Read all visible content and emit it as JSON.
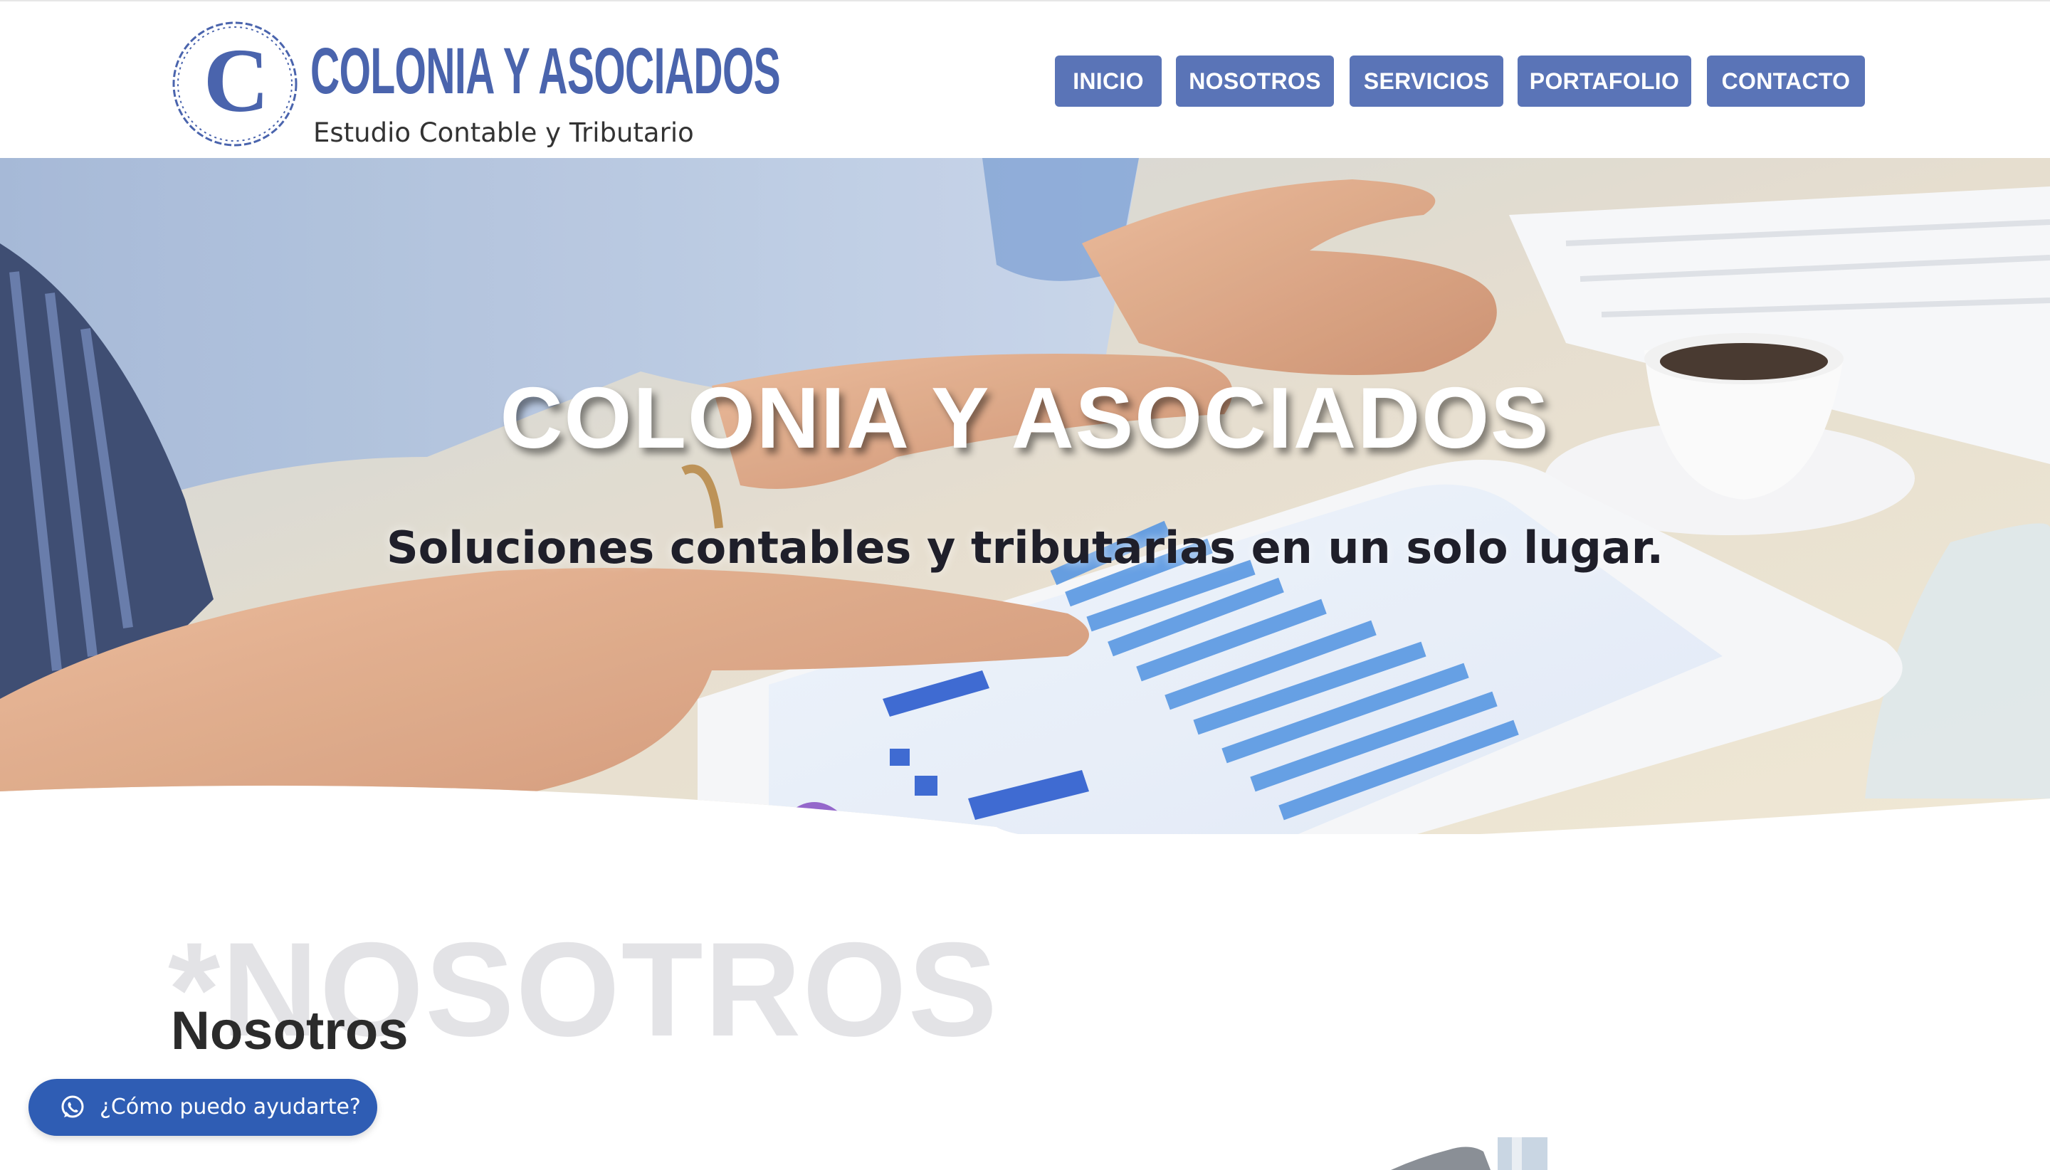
{
  "brand": {
    "logo_letter": "C",
    "name": "COLONIA Y ASOCIADOS",
    "tagline": "Estudio Contable y Tributario"
  },
  "nav": {
    "items": [
      {
        "label": "INICIO"
      },
      {
        "label": "NOSOTROS"
      },
      {
        "label": "SERVICIOS"
      },
      {
        "label": "PORTAFOLIO"
      },
      {
        "label": "CONTACTO"
      }
    ]
  },
  "hero": {
    "title": "COLONIA Y ASOCIADOS",
    "subtitle": "Soluciones contables y tributarias en un solo lugar."
  },
  "about": {
    "ghost_heading": "*NOSOTROS",
    "heading": "Nosotros"
  },
  "whatsapp": {
    "label": "¿Cómo puedo ayudarte?",
    "icon": "whatsapp-icon"
  },
  "colors": {
    "brand_blue": "#4a64ad",
    "nav_button": "#5a74b7",
    "whatsapp_button": "#2f5db4",
    "ghost_text": "#e3e3e6"
  }
}
